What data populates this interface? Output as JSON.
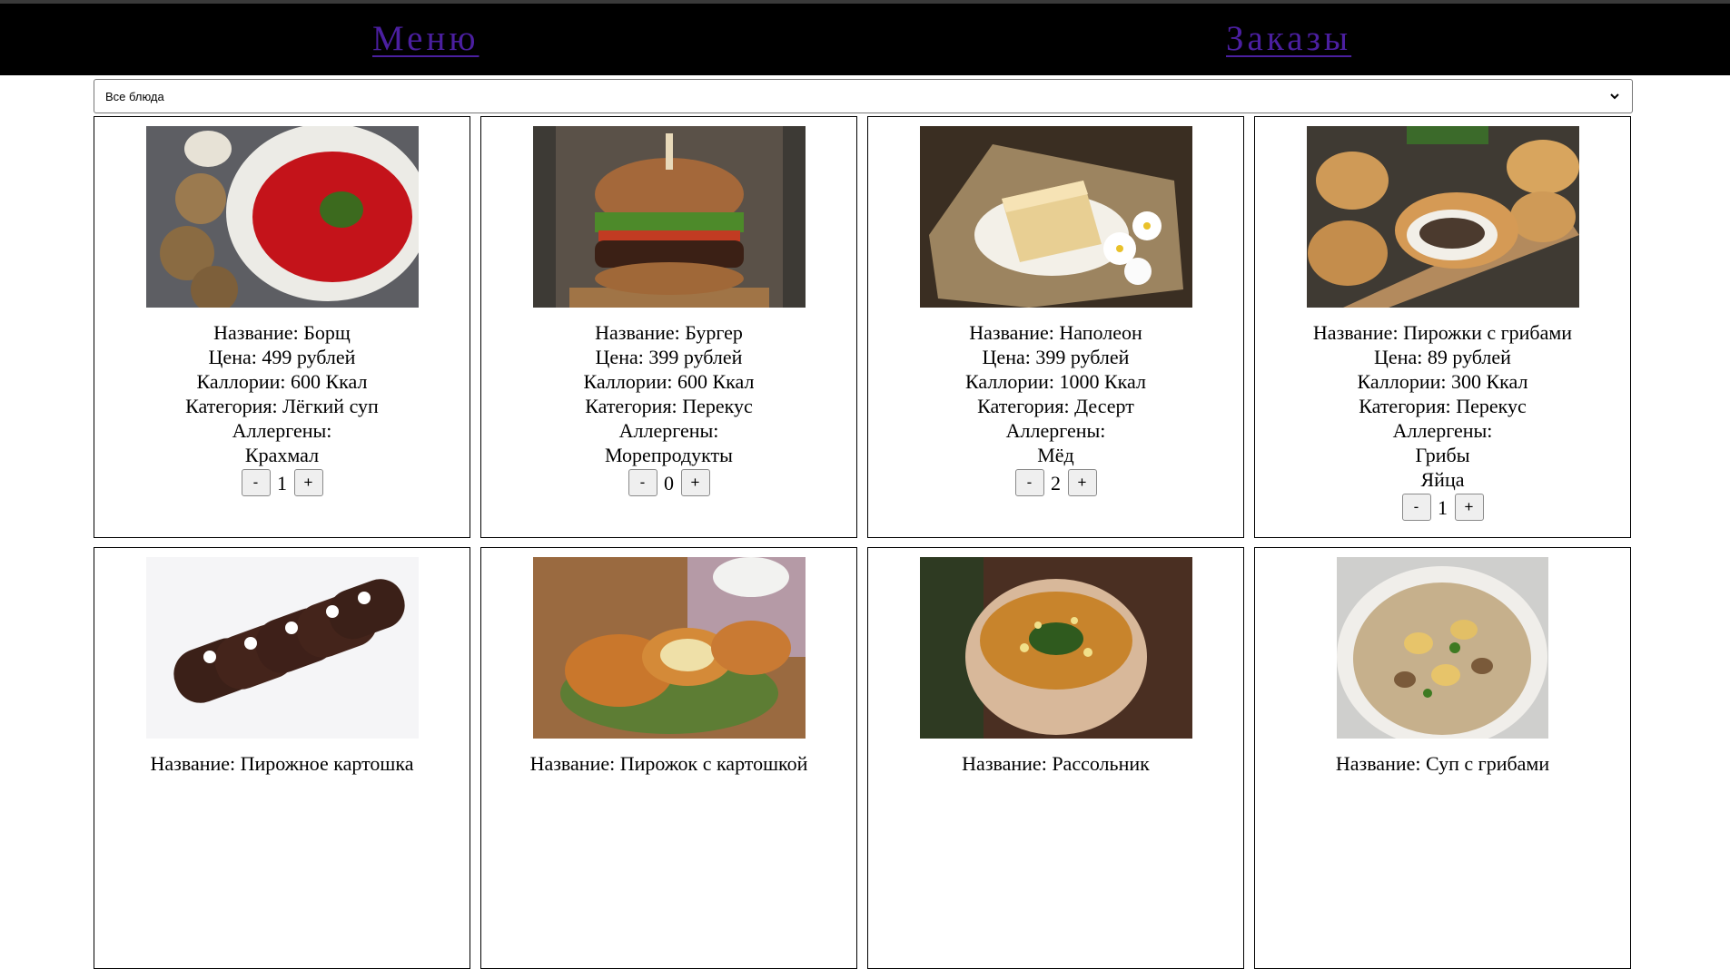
{
  "nav": {
    "menu_label": "Меню",
    "orders_label": "Заказы",
    "link_color": "#4b1fa0",
    "bar_color": "#000000"
  },
  "filter": {
    "selected": "Все блюда"
  },
  "labels": {
    "name_prefix": "Название: ",
    "price_prefix": "Цена: ",
    "calories_prefix": "Каллории: ",
    "category_prefix": "Категория: ",
    "allergens": "Аллергены:",
    "minus": "-",
    "plus": "+"
  },
  "dishes": [
    {
      "photo": "borscht-photo",
      "name": "Борщ",
      "price": "499 рублей",
      "calories": "600 Ккал",
      "category": "Лёгкий суп",
      "allergens": [
        "Крахмал"
      ],
      "qty": "1"
    },
    {
      "photo": "burger-photo",
      "name": "Бургер",
      "price": "399 рублей",
      "calories": "600 Ккал",
      "category": "Перекус",
      "allergens": [
        "Морепродукты"
      ],
      "qty": "0"
    },
    {
      "photo": "napoleon-photo",
      "name": "Наполеон",
      "price": "399 рублей",
      "calories": "1000 Ккал",
      "category": "Десерт",
      "allergens": [
        "Мёд"
      ],
      "qty": "2"
    },
    {
      "photo": "mushroom-pies-photo",
      "name": "Пирожки с грибами",
      "price": "89 рублей",
      "calories": "300 Ккал",
      "category": "Перекус",
      "allergens": [
        "Грибы",
        "Яйца"
      ],
      "qty": "1"
    },
    {
      "photo": "kartoshka-cake-photo",
      "name": "Пирожное картошка"
    },
    {
      "photo": "potato-pie-photo",
      "name": "Пирожок с картошкой"
    },
    {
      "photo": "rassolnik-photo",
      "name": "Рассольник"
    },
    {
      "photo": "mushroom-soup-photo",
      "name": "Суп с грибами"
    }
  ]
}
